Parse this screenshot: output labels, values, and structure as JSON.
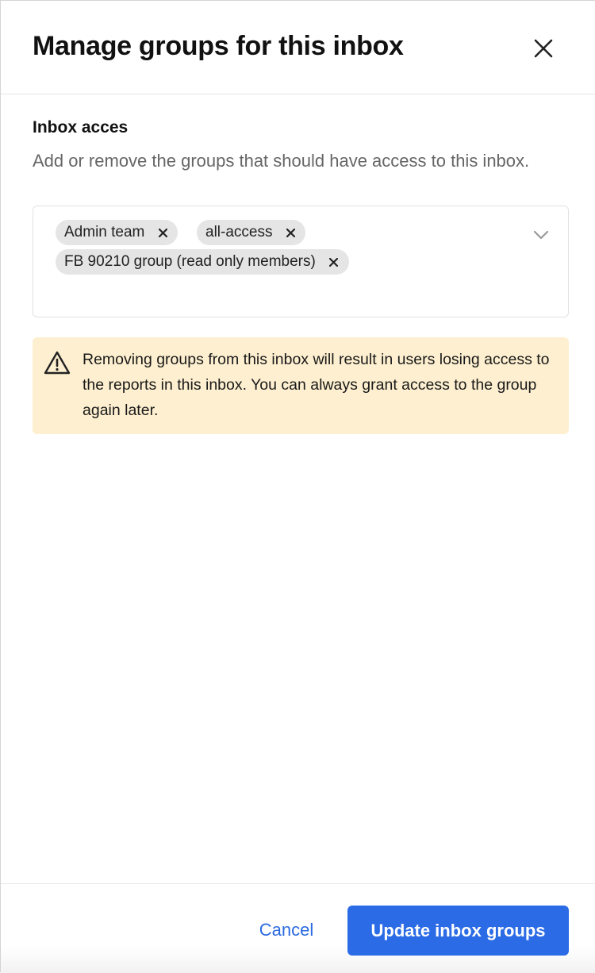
{
  "modal": {
    "title": "Manage groups for this inbox",
    "close_icon": "close-icon"
  },
  "access": {
    "label": "Inbox acces",
    "description": "Add or remove the groups that should have access to this inbox.",
    "selected_groups": [
      {
        "label": "Admin team",
        "remove_icon": "remove-chip-icon"
      },
      {
        "label": "all-access",
        "remove_icon": "remove-chip-icon"
      },
      {
        "label": "FB 90210 group (read only members)",
        "remove_icon": "remove-chip-icon"
      }
    ],
    "dropdown_icon": "chevron-down-icon"
  },
  "warning": {
    "icon": "warning-triangle-icon",
    "text": "Removing groups from this inbox will result in users losing access to the reports in this inbox. You can always grant access to the group again later.",
    "background": "#fdefcf"
  },
  "footer": {
    "cancel_label": "Cancel",
    "submit_label": "Update inbox groups"
  },
  "colors": {
    "accent": "#2b6be6",
    "chip": "#e5e5e5",
    "muted_text": "#666666"
  }
}
